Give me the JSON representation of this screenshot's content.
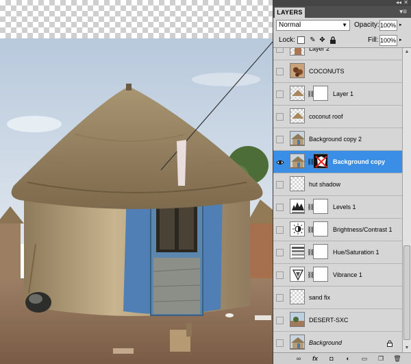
{
  "panel": {
    "tab_label": "LAYERS",
    "blend_mode": "Normal",
    "opacity_label": "Opacity:",
    "opacity_value": "100%",
    "lock_label": "Lock:",
    "fill_label": "Fill:",
    "fill_value": "100%"
  },
  "layers": [
    {
      "name": "Layer 2",
      "visible": false,
      "thumb": "checker-figure"
    },
    {
      "name": "COCONUTS",
      "visible": false,
      "thumb": "coconuts"
    },
    {
      "name": "Layer 1",
      "visible": false,
      "thumb": "roof-piece",
      "mask": "white-mask"
    },
    {
      "name": "coconut roof",
      "visible": false,
      "thumb": "roof-piece"
    },
    {
      "name": "Background copy 2",
      "visible": false,
      "thumb": "hut"
    },
    {
      "name": "Background copy",
      "visible": true,
      "selected": true,
      "thumb": "hut",
      "mask": "black-mask"
    },
    {
      "name": "hut shadow",
      "visible": false,
      "thumb": "checker"
    },
    {
      "name": "Levels 1",
      "visible": false,
      "thumb": "levels-adjust",
      "mask": "white-mask"
    },
    {
      "name": "Brightness/Contrast 1",
      "visible": false,
      "thumb": "brightness-adjust",
      "mask": "white-mask"
    },
    {
      "name": "Hue/Saturation 1",
      "visible": false,
      "thumb": "hue-adjust",
      "mask": "white-mask"
    },
    {
      "name": "Vibrance 1",
      "visible": false,
      "thumb": "vibrance-adjust",
      "mask": "white-mask"
    },
    {
      "name": "sand fix",
      "visible": false,
      "thumb": "checker"
    },
    {
      "name": "DESERT-SXC",
      "visible": false,
      "thumb": "desert"
    },
    {
      "name": "Background",
      "visible": false,
      "thumb": "hut",
      "locked": true,
      "italic": true
    }
  ],
  "icons": {
    "topbar": [
      "collapse-icon",
      "close-icon"
    ],
    "panel_menu": "panel-menu-icon",
    "lock_buttons": [
      "lock-transparent-pixels-icon",
      "lock-image-pixels-icon",
      "lock-position-icon",
      "lock-all-icon"
    ],
    "bottom_buttons": [
      "link-layers-icon",
      "add-layer-style-icon",
      "add-mask-icon",
      "new-adjustment-layer-icon",
      "new-group-icon",
      "new-layer-icon",
      "delete-layer-icon"
    ]
  },
  "colors": {
    "selection": "#3a8ee6",
    "panel_bg": "#d6d6d6",
    "tab_bar": "#4f4f4f"
  }
}
